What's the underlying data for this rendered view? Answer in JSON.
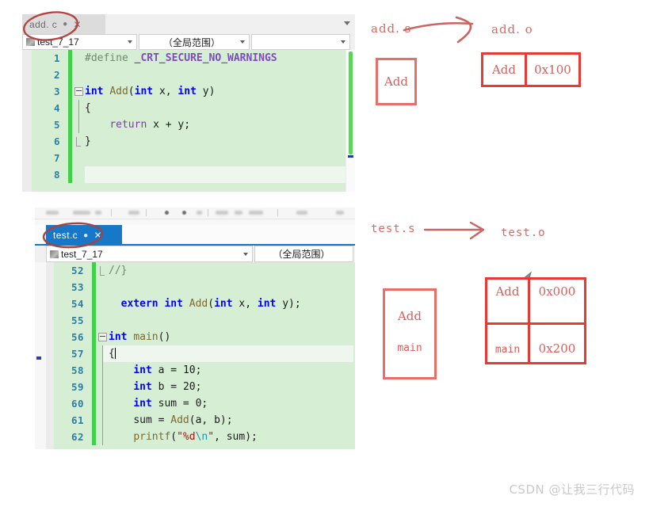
{
  "top_editor": {
    "tab": {
      "label": "add. c",
      "pin_icon": "pin-icon",
      "close_icon": "close-icon"
    },
    "nav": {
      "project": "test_7_17",
      "scope": "（全局范围）",
      "member": ""
    },
    "lines": [
      {
        "n": "1",
        "text": "#define _CRT_SECURE_NO_WARNINGS"
      },
      {
        "n": "2",
        "text": ""
      },
      {
        "n": "3",
        "text": "int Add(int x, int y)"
      },
      {
        "n": "4",
        "text": "{"
      },
      {
        "n": "5",
        "text": "    return x + y;"
      },
      {
        "n": "6",
        "text": "}"
      },
      {
        "n": "7",
        "text": ""
      },
      {
        "n": "8",
        "text": ""
      }
    ]
  },
  "bottom_editor": {
    "tab": {
      "label": "test.c",
      "pin_icon": "pin-icon",
      "close_icon": "close-icon"
    },
    "nav": {
      "project": "test_7_17",
      "scope": "（全局范围）"
    },
    "lines": [
      {
        "n": "52",
        "text": "//}"
      },
      {
        "n": "53",
        "text": ""
      },
      {
        "n": "54",
        "text": "  extern int Add(int x, int y);"
      },
      {
        "n": "55",
        "text": ""
      },
      {
        "n": "56",
        "text": "int main()"
      },
      {
        "n": "57",
        "text": "{"
      },
      {
        "n": "58",
        "text": "    int a = 10;"
      },
      {
        "n": "59",
        "text": "    int b = 20;"
      },
      {
        "n": "60",
        "text": "    int sum = 0;"
      },
      {
        "n": "61",
        "text": "    sum = Add(a, b);"
      },
      {
        "n": "62",
        "text": "    printf(\"%d\\n\", sum);"
      }
    ]
  },
  "diagram_top": {
    "source_label": "add. s",
    "target_label": "add. o",
    "source_box": {
      "cell": "Add"
    },
    "target_table": {
      "rows": [
        {
          "symbol": "Add",
          "address": "0x100"
        }
      ]
    }
  },
  "diagram_bottom": {
    "source_label": "test.s",
    "target_label": "test.o",
    "source_box": {
      "cell_1": "Add",
      "cell_2": "main"
    },
    "target_table": {
      "rows": [
        {
          "symbol": "Add",
          "address": "0x000"
        },
        {
          "symbol": "main",
          "address": "0x200"
        }
      ]
    }
  },
  "watermark": {
    "text": "CSDN @让我三行代码"
  },
  "colors": {
    "annotation_red": "#e63a34",
    "diagram_red": "#d4605c",
    "code_background": "#d6eed4",
    "change_bar_green": "#3fd148",
    "active_tab_blue": "#1878c8",
    "line_number_blue": "#2a7fa8"
  }
}
